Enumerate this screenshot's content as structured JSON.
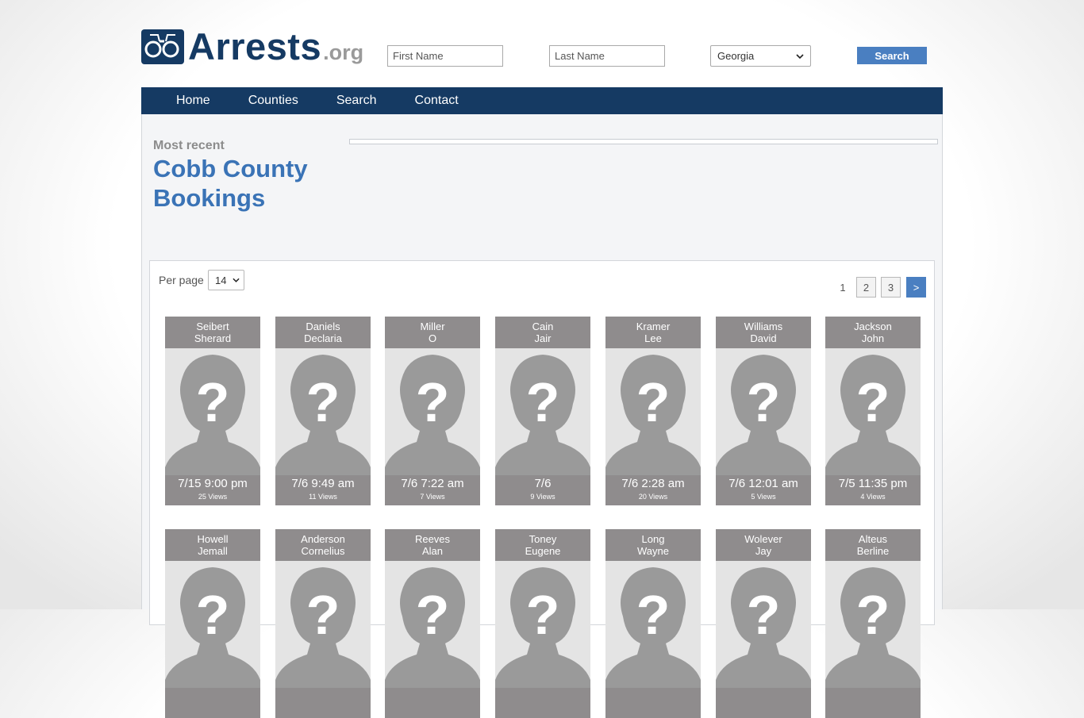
{
  "header": {
    "logo_text": "Arrests",
    "logo_suffix": ".org",
    "first_name_placeholder": "First Name",
    "last_name_placeholder": "Last Name",
    "state_selected": "Georgia",
    "search_label": "Search"
  },
  "nav": {
    "items": [
      "Home",
      "Counties",
      "Search",
      "Contact"
    ]
  },
  "page": {
    "eyebrow": "Most recent",
    "title": "Cobb County Bookings"
  },
  "listing": {
    "per_page_label": "Per page",
    "per_page_value": "14",
    "pagination": {
      "current": "1",
      "pages": [
        "2",
        "3"
      ],
      "next": ">"
    },
    "cards": [
      {
        "last": "Seibert",
        "first": "Sherard",
        "date": "7/15 9:00 pm",
        "views": "25 Views"
      },
      {
        "last": "Daniels",
        "first": "Declaria",
        "date": "7/6 9:49 am",
        "views": "11 Views"
      },
      {
        "last": "Miller",
        "first": "O",
        "date": "7/6 7:22 am",
        "views": "7 Views"
      },
      {
        "last": "Cain",
        "first": "Jair",
        "date": "7/6",
        "views": "9 Views"
      },
      {
        "last": "Kramer",
        "first": "Lee",
        "date": "7/6 2:28 am",
        "views": "20 Views"
      },
      {
        "last": "Williams",
        "first": "David",
        "date": "7/6 12:01 am",
        "views": "5 Views"
      },
      {
        "last": "Jackson",
        "first": "John",
        "date": "7/5 11:35 pm",
        "views": "4 Views"
      },
      {
        "last": "Howell",
        "first": "Jemall",
        "date": "",
        "views": ""
      },
      {
        "last": "Anderson",
        "first": "Cornelius",
        "date": "",
        "views": ""
      },
      {
        "last": "Reeves",
        "first": "Alan",
        "date": "",
        "views": ""
      },
      {
        "last": "Toney",
        "first": "Eugene",
        "date": "",
        "views": ""
      },
      {
        "last": "Long",
        "first": "Wayne",
        "date": "",
        "views": ""
      },
      {
        "last": "Wolever",
        "first": "Jay",
        "date": "",
        "views": ""
      },
      {
        "last": "Alteus",
        "first": "Berline",
        "date": "",
        "views": ""
      }
    ]
  },
  "icons": {
    "logo": "handcuffs-logo-icon",
    "dropdown": "chevron-down-icon",
    "placeholder_photo": "unknown-person-icon"
  },
  "colors": {
    "brand_navy": "#153a63",
    "accent_blue": "#4a7fc1",
    "title_blue": "#3a73b6",
    "card_gray": "#8f8c8d"
  }
}
